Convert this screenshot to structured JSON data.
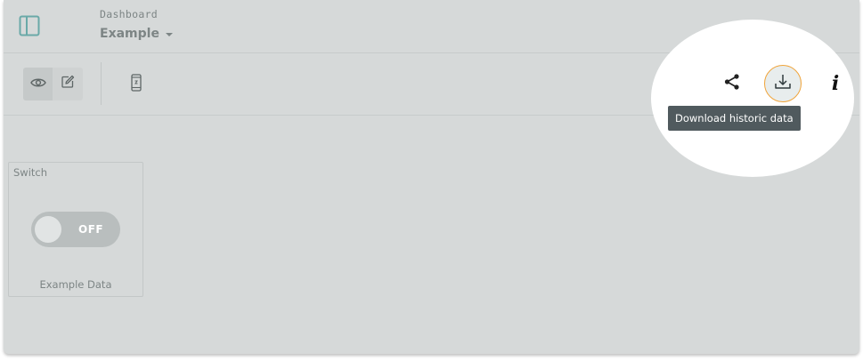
{
  "header": {
    "breadcrumb": "Dashboard",
    "title": "Example",
    "sidebar_toggle_icon": "sidebar-panel-icon",
    "title_dropdown_icon": "caret-down-icon"
  },
  "toolbar": {
    "mode_buttons": [
      {
        "icon": "eye-icon",
        "label": "View",
        "selected": true
      },
      {
        "icon": "pencil-edit-icon",
        "label": "Edit",
        "selected": false
      }
    ],
    "device_preview_icon": "mobile-phone-icon",
    "actions": [
      {
        "icon": "share-icon"
      },
      {
        "icon": "download-icon",
        "highlighted": true
      },
      {
        "icon": "info-icon",
        "glyph": "i"
      }
    ],
    "tooltip": "Download historic data"
  },
  "widgets": [
    {
      "type": "switch",
      "title": "Switch",
      "state_label": "OFF",
      "state_on": false,
      "caption": "Example Data"
    }
  ],
  "colors": {
    "overlay_bg": "#d6d9d9",
    "accent_highlight": "#f0a43a",
    "icon_teal": "#4fa3a3",
    "tooltip_bg": "#505a5e"
  }
}
